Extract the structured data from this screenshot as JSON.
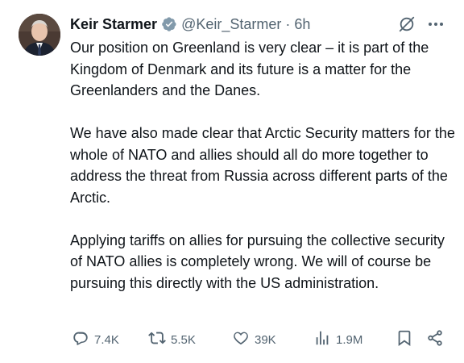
{
  "author": {
    "name": "Keir Starmer",
    "handle": "@Keir_Starmer",
    "separator": "·",
    "time": "6h",
    "verified_icon": "verified-badge-icon",
    "badge_color": "#829aab"
  },
  "tweet": {
    "paragraphs": [
      "Our position on Greenland is very clear – it is part of the Kingdom of Denmark and its future is a matter for the Greenlanders and the Danes.",
      "We have also made clear that Arctic Security matters for the whole of NATO and allies should all do more together to address the threat from Russia across different parts of the Arctic.",
      "Applying tariffs on allies for pursuing the collective security of NATO allies is completely wrong. We will of course be pursuing this directly with the US administration."
    ]
  },
  "actions": {
    "reply": {
      "icon": "reply-icon",
      "count": "7.4K"
    },
    "retweet": {
      "icon": "retweet-icon",
      "count": "5.5K"
    },
    "like": {
      "icon": "heart-icon",
      "count": "39K"
    },
    "views": {
      "icon": "views-icon",
      "count": "1.9M"
    },
    "bookmark": {
      "icon": "bookmark-icon"
    },
    "share": {
      "icon": "share-icon"
    }
  },
  "header_icons": {
    "grok": "grok-icon",
    "more": "more-icon"
  },
  "colors": {
    "text": "#0f1419",
    "secondary": "#536471",
    "background": "#ffffff"
  }
}
